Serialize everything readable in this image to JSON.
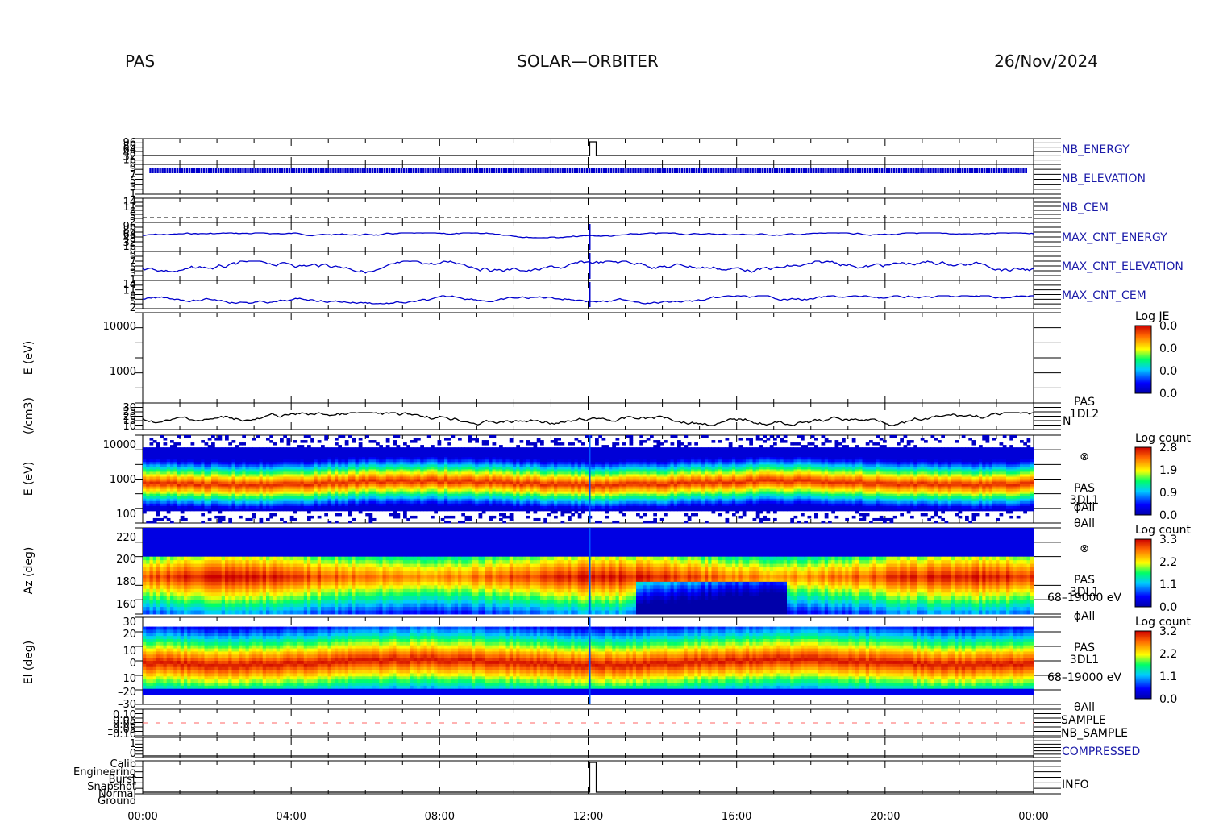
{
  "header": {
    "left": "PAS",
    "center": "SOLAR—ORBITER",
    "right": "26/Nov/2024"
  },
  "colors": {
    "blue_label": "#1a1aa8",
    "red_label": "#cc1111",
    "trace_blue": "#0000cc"
  },
  "chart_data": [
    {
      "type": "line",
      "name": "NB_ENERGY",
      "ticks": [
        "96",
        "80",
        "64",
        "48",
        "32",
        "16",
        "0"
      ],
      "x": [
        "00:00",
        "12:00",
        "12:10",
        "24:00"
      ],
      "values": [
        1,
        1,
        0.6,
        0.6
      ]
    },
    {
      "type": "line",
      "name": "NB_ELEVATION",
      "ticks": [
        "9",
        "7",
        "5",
        "3",
        "1"
      ]
    },
    {
      "type": "line",
      "name": "NB_CEM",
      "ticks": [
        "14",
        "11",
        "8",
        "5",
        "2"
      ]
    },
    {
      "type": "line",
      "name": "MAX_CNT_ENERGY",
      "ticks": [
        "96",
        "80",
        "64",
        "48",
        "32",
        "16",
        "0"
      ]
    },
    {
      "type": "line",
      "name": "MAX_CNT_ELEVATION",
      "ticks": [
        "9",
        "7",
        "5",
        "3",
        "1"
      ]
    },
    {
      "type": "line",
      "name": "MAX_CNT_CEM",
      "ticks": [
        "14",
        "11",
        "8",
        "5",
        "2"
      ]
    },
    {
      "type": "heatmap",
      "ylabel": "E (eV)",
      "ticks": [
        "10000",
        "1000"
      ],
      "colorbar": {
        "title": "Log JE",
        "labels": [
          "0.0",
          "0.0",
          "0.0",
          "0.0"
        ]
      }
    },
    {
      "type": "line",
      "ylabel": "(/cm3)",
      "ticks": [
        "30",
        "25",
        "20",
        "15",
        "10"
      ],
      "labels": [
        "PAS",
        "1DL2",
        "N"
      ]
    },
    {
      "type": "heatmap",
      "ylabel": "E (eV)",
      "ticks": [
        "10000",
        "1000",
        "100"
      ],
      "labels": [
        "⊗",
        "PAS",
        "3DL1",
        "ϕAll",
        "θAll"
      ],
      "colorbar": {
        "title": "Log count",
        "labels": [
          "2.8",
          "1.9",
          "0.9",
          "0.0"
        ]
      }
    },
    {
      "type": "heatmap",
      "ylabel": "Az (deg)",
      "ticks": [
        "220",
        "200",
        "180",
        "160"
      ],
      "labels": [
        "⊗",
        "PAS",
        "3DL1",
        "68–19000 eV",
        "ϕAll"
      ],
      "colorbar": {
        "title": "Log count",
        "labels": [
          "3.3",
          "2.2",
          "1.1",
          "0.0"
        ]
      }
    },
    {
      "type": "heatmap",
      "ylabel": "El (deg)",
      "ticks": [
        "30",
        "20",
        "10",
        "0",
        "–10",
        "–20",
        "–30"
      ],
      "labels": [
        "PAS",
        "3DL1",
        "68–19000 eV",
        "θAll"
      ],
      "colorbar": {
        "title": "Log count",
        "labels": [
          "3.2",
          "2.2",
          "1.1",
          "0.0"
        ]
      }
    },
    {
      "type": "line",
      "ticks": [
        "0.10",
        "0.05",
        "0.00",
        "–0.05",
        "–0.10"
      ],
      "labels": [
        "SAMPLE",
        "NB_SAMPLE"
      ]
    },
    {
      "type": "line",
      "name": "COMPRESSED",
      "ticks": [
        "1",
        "0"
      ]
    },
    {
      "type": "line",
      "name": "INFO",
      "ticks": [
        "Calib",
        "Engineering",
        "Burst",
        "Snapshot",
        "Normal",
        "Ground"
      ],
      "x": [
        "00:00",
        "12:00",
        "12:10",
        "24:00"
      ],
      "values": [
        "Normal",
        "Calib",
        "Normal",
        "Normal"
      ]
    }
  ],
  "xaxis": {
    "ticks": [
      "00:00",
      "04:00",
      "08:00",
      "12:00",
      "16:00",
      "20:00",
      "00:00"
    ]
  }
}
